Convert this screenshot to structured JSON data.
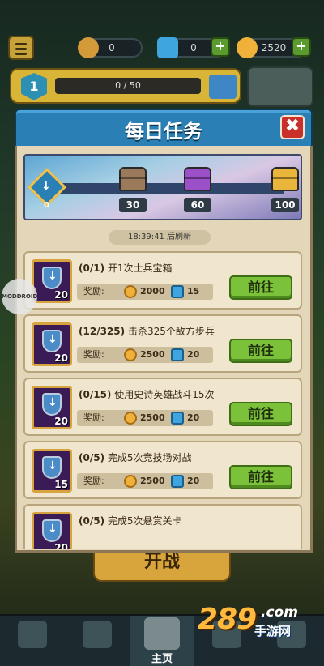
{
  "topbar": {
    "resources": [
      {
        "icon": "bone-icon",
        "value": "0"
      },
      {
        "icon": "gem-icon",
        "value": "0"
      },
      {
        "icon": "coin-icon",
        "value": "2520"
      }
    ],
    "level": "1",
    "xp_text": "0 / 50"
  },
  "modal": {
    "title": "每日任务",
    "close_symbol": "✖",
    "progress": {
      "current": "0",
      "milestones": [
        "30",
        "60",
        "100"
      ]
    },
    "refresh_text": "18:39:41 后刷新",
    "reward_label": "奖励:",
    "go_label": "前往",
    "quests": [
      {
        "progress": "(0/1)",
        "text": "开1次士兵宝箱",
        "points": "20",
        "coins": "2000",
        "gems": "15"
      },
      {
        "progress": "(12/325)",
        "text": "击杀325个敌方步兵",
        "points": "20",
        "coins": "2500",
        "gems": "20"
      },
      {
        "progress": "(0/15)",
        "text": "使用史诗英雄战斗15次",
        "points": "20",
        "coins": "2500",
        "gems": "20"
      },
      {
        "progress": "(0/5)",
        "text": "完成5次竞技场对战",
        "points": "15",
        "coins": "2500",
        "gems": "20"
      },
      {
        "progress": "(0/5)",
        "text": "完成5次悬赏关卡",
        "points": "20",
        "coins": "",
        "gems": ""
      }
    ]
  },
  "start_label": "开战",
  "nav": {
    "active_label": "主页"
  },
  "watermark": "MODDROID",
  "brand": {
    "num": "289",
    "com": ".com",
    "sub": "手游网"
  },
  "colors": {
    "header_blue": "#2a7fb4",
    "go_green": "#7bc13a",
    "panel": "#e4d7b9"
  }
}
